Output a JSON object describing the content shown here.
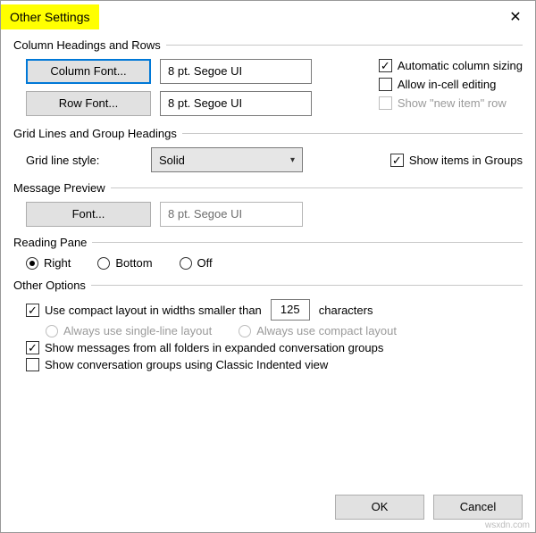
{
  "window": {
    "title": "Other Settings",
    "close_glyph": "✕"
  },
  "columns": {
    "legend": "Column Headings and Rows",
    "column_font_btn": "Column Font...",
    "column_font_value": "8 pt. Segoe UI",
    "row_font_btn": "Row Font...",
    "row_font_value": "8 pt. Segoe UI",
    "auto_sizing": "Automatic column sizing",
    "allow_incell": "Allow in-cell editing",
    "show_new_item": "Show \"new item\" row"
  },
  "gridlines": {
    "legend": "Grid Lines and Group Headings",
    "style_label": "Grid line style:",
    "style_value": "Solid",
    "show_groups": "Show items in Groups"
  },
  "preview": {
    "legend": "Message Preview",
    "font_btn": "Font...",
    "font_value": "8 pt. Segoe UI"
  },
  "reading": {
    "legend": "Reading Pane",
    "right": "Right",
    "bottom": "Bottom",
    "off": "Off"
  },
  "other": {
    "legend": "Other Options",
    "compact_prefix": "Use compact layout in widths smaller than",
    "compact_value": "125",
    "compact_suffix": "characters",
    "always_single": "Always use single-line layout",
    "always_compact": "Always use compact layout",
    "show_msgs": "Show messages from all folders in expanded conversation groups",
    "classic_indent": "Show conversation groups using Classic Indented view"
  },
  "footer": {
    "ok": "OK",
    "cancel": "Cancel"
  },
  "checkmark": "✓",
  "watermark": "wsxdn.com"
}
